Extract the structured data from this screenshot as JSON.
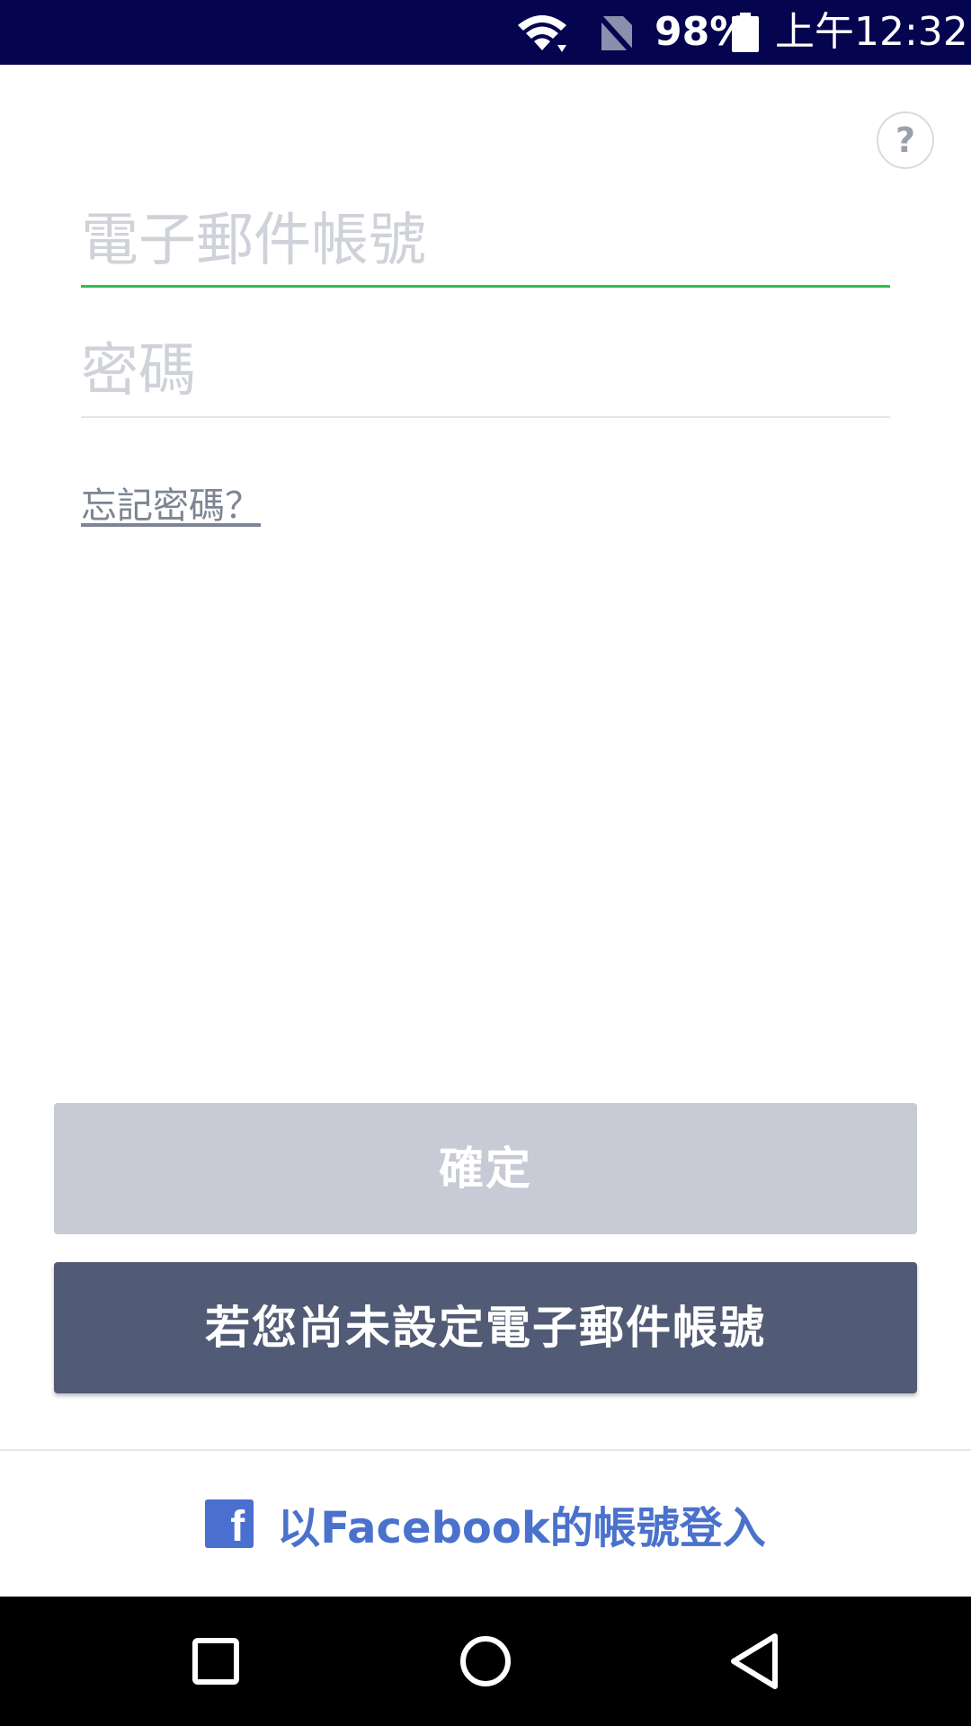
{
  "status_bar": {
    "battery_percent": "98%",
    "time": "上午12:32",
    "icons": [
      "wifi-icon",
      "no-sim-icon",
      "battery-icon"
    ]
  },
  "help": {
    "label": "?"
  },
  "form": {
    "email_placeholder": "電子郵件帳號",
    "email_value": "",
    "password_placeholder": "密碼",
    "password_value": "",
    "forgot_password": "忘記密碼？"
  },
  "buttons": {
    "confirm": "確定",
    "setup_email": "若您尚未設定電子郵件帳號"
  },
  "facebook": {
    "icon_letter": "f",
    "label": "以Facebook的帳號登入"
  },
  "colors": {
    "status_bar": "#05044f",
    "focus_underline": "#2fbf4a",
    "confirm_disabled": "#c8cbd5",
    "secondary_button": "#525b75",
    "facebook_blue": "#4a72cc"
  },
  "navigation": {
    "icons": [
      "recent-apps-icon",
      "home-icon",
      "back-icon"
    ]
  }
}
